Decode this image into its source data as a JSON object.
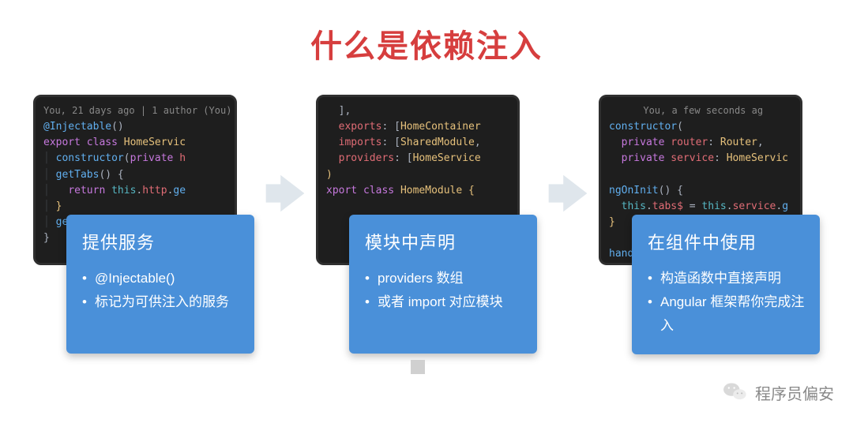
{
  "title": "什么是依赖注入",
  "columns": [
    {
      "code_html": "<span class='gb'>You, 21 days ago | 1 author (You)</span>\n<span class='fn'>@Injectable</span><span class='pu'>()</span>\n<span class='kw'>export</span> <span class='kw'>class</span> <span class='cl'>HomeServic</span>\n<span class='indent'>│ </span><span class='fn'>constructor</span><span class='pu'>(</span><span class='kw'>private</span> <span class='vr'>h</span>\n<span class='indent'>│ </span><span class='fn'>getTabs</span><span class='pu'>() {</span>\n<span class='indent'>│   </span><span class='kw'>return</span> <span class='tl'>this</span><span class='pu'>.</span><span class='vr'>http</span><span class='pu'>.</span><span class='fn'>ge</span>\n<span class='indent'>│ </span><span class='st'>}</span>\n<span class='indent'>│ </span><span class='fn'>ge</span>\n<span class='pu'>}</span>",
      "card_title": "提供服务",
      "bullets": [
        "@Injectable()",
        "标记为可供注入的服务"
      ]
    },
    {
      "code_html": "  <span class='pu'>],</span>\n  <span class='vr'>exports</span><span class='pu'>: [</span><span class='cl'>HomeContainer</span>\n  <span class='vr'>imports</span><span class='pu'>: [</span><span class='cl'>SharedModule</span><span class='pu'>,</span>\n  <span class='vr'>providers</span><span class='pu'>: [</span><span class='cl'>HomeService</span>\n<span class='st'>)</span>\n<span class='kw'>xport</span> <span class='kw'>class</span> <span class='cl'>HomeModule</span> <span class='st'>{</span>\n",
      "card_title": "模块中声明",
      "bullets": [
        "providers 数组",
        "或者 import 对应模块"
      ]
    },
    {
      "code_html": "<span class='gb'>      You, a few seconds ag</span>\n<span class='fn'>constructor</span><span class='pu'>(</span>\n  <span class='kw'>private</span> <span class='vr'>router</span><span class='pu'>:</span> <span class='cl'>Router</span><span class='pu'>,</span>\n  <span class='kw'>private</span> <span class='vr'>service</span><span class='pu'>:</span> <span class='cl'>HomeServic</span>\n\n<span class='fn'>ngOnInit</span><span class='pu'>() {</span>\n  <span class='tl'>this</span><span class='pu'>.</span><span class='vr'>tabs$</span> <span class='pu'>=</span> <span class='tl'>this</span><span class='pu'>.</span><span class='vr'>service</span><span class='pu'>.</span><span class='fn'>g</span>\n<span class='st'>}</span>\n\n<span class='fn'>handleTabSelected</span><span class='pu'>(</span><span class='vr'>tabItem</span><span class='pu'>:</span> <span class='cl'>Ta</span>\n    <span class='tl'>thi</span>",
      "card_title": "在组件中使用",
      "bullets": [
        "构造函数中直接声明",
        "Angular 框架帮你完成注入"
      ]
    }
  ],
  "watermark": "程序员偏安"
}
